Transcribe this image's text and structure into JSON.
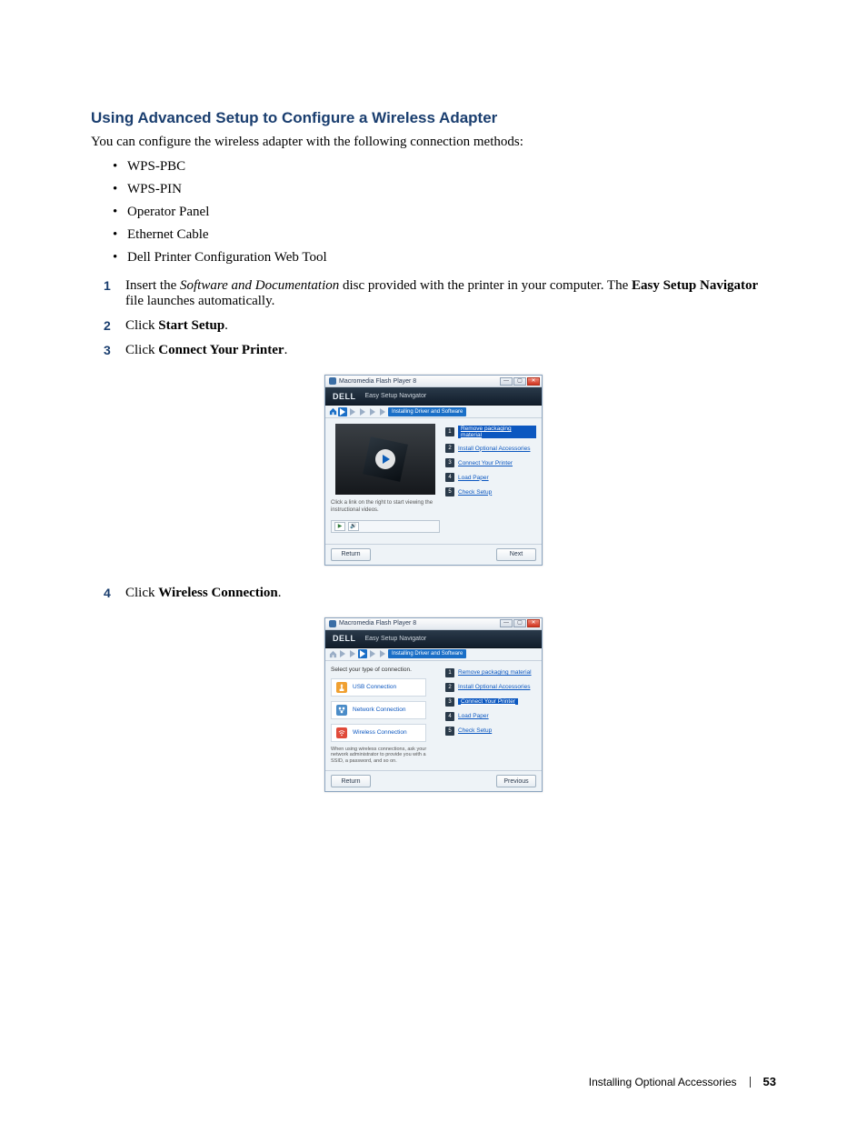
{
  "heading": "Using Advanced Setup to Configure a Wireless Adapter",
  "intro": "You can configure the wireless adapter with the following connection methods:",
  "bullets": [
    "WPS-PBC",
    "WPS-PIN",
    "Operator Panel",
    "Ethernet Cable",
    "Dell Printer Configuration Web Tool"
  ],
  "steps": {
    "s1_prefix": "Insert the ",
    "s1_italic": "Software and Documentation",
    "s1_mid": " disc provided with the printer in your computer. The ",
    "s1_bold": "Easy Setup Navigator",
    "s1_suffix": " file launches automatically.",
    "s2_prefix": "Click ",
    "s2_bold": "Start Setup",
    "s2_suffix": ".",
    "s3_prefix": "Click ",
    "s3_bold": "Connect Your Printer",
    "s3_suffix": ".",
    "s4_prefix": "Click ",
    "s4_bold": "Wireless Connection",
    "s4_suffix": "."
  },
  "screenshot1": {
    "window_title": "Macromedia Flash Player 8",
    "brand": "DELL",
    "brand_sub": "Easy Setup Navigator",
    "crumb_label": "Installing Driver and Software",
    "caption": "Click a link on the right to start viewing the instructional videos.",
    "nav_return": "Return",
    "nav_next": "Next",
    "side_steps": [
      {
        "num": "1",
        "label": "Remove packaging material",
        "active": true
      },
      {
        "num": "2",
        "label": "Install Optional Accessories",
        "active": false
      },
      {
        "num": "3",
        "label": "Connect Your Printer",
        "active": false
      },
      {
        "num": "4",
        "label": "Load Paper",
        "active": false
      },
      {
        "num": "5",
        "label": "Check Setup",
        "active": false
      }
    ]
  },
  "screenshot2": {
    "window_title": "Macromedia Flash Player 8",
    "brand": "DELL",
    "brand_sub": "Easy Setup Navigator",
    "crumb_label": "Installing Driver and Software",
    "left_heading": "Select your type of connection.",
    "conn_usb": "USB Connection",
    "conn_net": "Network Connection",
    "conn_wifi": "Wireless Connection",
    "footnote": "When using wireless connections, ask your network administrator to provide you with a SSID, a password, and so on.",
    "nav_return": "Return",
    "nav_prev": "Previous",
    "side_steps": [
      {
        "num": "1",
        "label": "Remove packaging material",
        "active": false
      },
      {
        "num": "2",
        "label": "Install Optional Accessories",
        "active": false
      },
      {
        "num": "3",
        "label": "Connect Your Printer",
        "active": true
      },
      {
        "num": "4",
        "label": "Load Paper",
        "active": false
      },
      {
        "num": "5",
        "label": "Check Setup",
        "active": false
      }
    ]
  },
  "footer": {
    "section": "Installing Optional Accessories",
    "page": "53"
  }
}
